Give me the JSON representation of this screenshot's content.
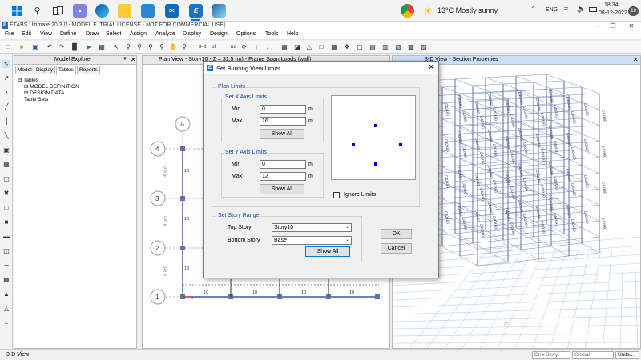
{
  "taskbar": {
    "weather": "13°C  Mostly sunny",
    "lang": "ENG",
    "time": "18:34",
    "date": "08-12-2022",
    "notif_count": "18"
  },
  "app": {
    "title": "ETABS Ultimate 20.3.0 - MODEL F  [TRIAL LICENSE - NOT FOR COMMERCIAL USE]"
  },
  "menu": [
    "File",
    "Edit",
    "View",
    "Define",
    "Draw",
    "Select",
    "Assign",
    "Analyze",
    "Display",
    "Design",
    "Options",
    "Tools",
    "Help"
  ],
  "toolbar": {
    "view_3d": "3-d",
    "view_plan": "pl",
    "view_elev": "nd"
  },
  "explorer": {
    "title": "Model Explorer",
    "tabs": [
      "Model",
      "Display",
      "Tables",
      "Reports"
    ],
    "tree": {
      "root": "Tables",
      "children": [
        "MODEL DEFINITION",
        "DESIGN DATA"
      ],
      "table_sets": "Table Sets"
    }
  },
  "planview": {
    "title": "Plan View - Story10 - Z = 31.5 (m) - Frame Span Loads (wall)",
    "grid_col": "A",
    "grid_rows": [
      "4",
      "3",
      "2",
      "1"
    ],
    "row_dims": [
      "4 (m)",
      "4 (m)",
      "4 (m)"
    ],
    "beam_labels": [
      "10",
      "10",
      "10",
      "10",
      "10"
    ],
    "col_labels": [
      "18",
      "18",
      "18"
    ]
  },
  "view3d": {
    "title": "3-D View - Section Properties",
    "section_label": "C40X60"
  },
  "dialog": {
    "title": "Set Building View Limits",
    "plan_limits": "Plan Limits",
    "x_limits": {
      "label": "Set X Axis Limits",
      "min_label": "Min",
      "min": "0",
      "max_label": "Max",
      "max": "16",
      "unit": "m",
      "show_all": "Show All"
    },
    "y_limits": {
      "label": "Set Y Axis Limits",
      "min_label": "Min",
      "min": "0",
      "max_label": "Max",
      "max": "12",
      "unit": "m",
      "show_all": "Show All"
    },
    "ignore_limits": "Ignore Limits",
    "story_range": {
      "label": "Set Story Range",
      "top_label": "Top Story",
      "top": "Story10",
      "bottom_label": "Bottom Story",
      "bottom": "Base",
      "show_all": "Show All"
    },
    "ok": "OK",
    "cancel": "Cancel"
  },
  "status": {
    "left": "3-D View",
    "story_mode": "One Story",
    "coord": "Global",
    "units": "Units..."
  }
}
